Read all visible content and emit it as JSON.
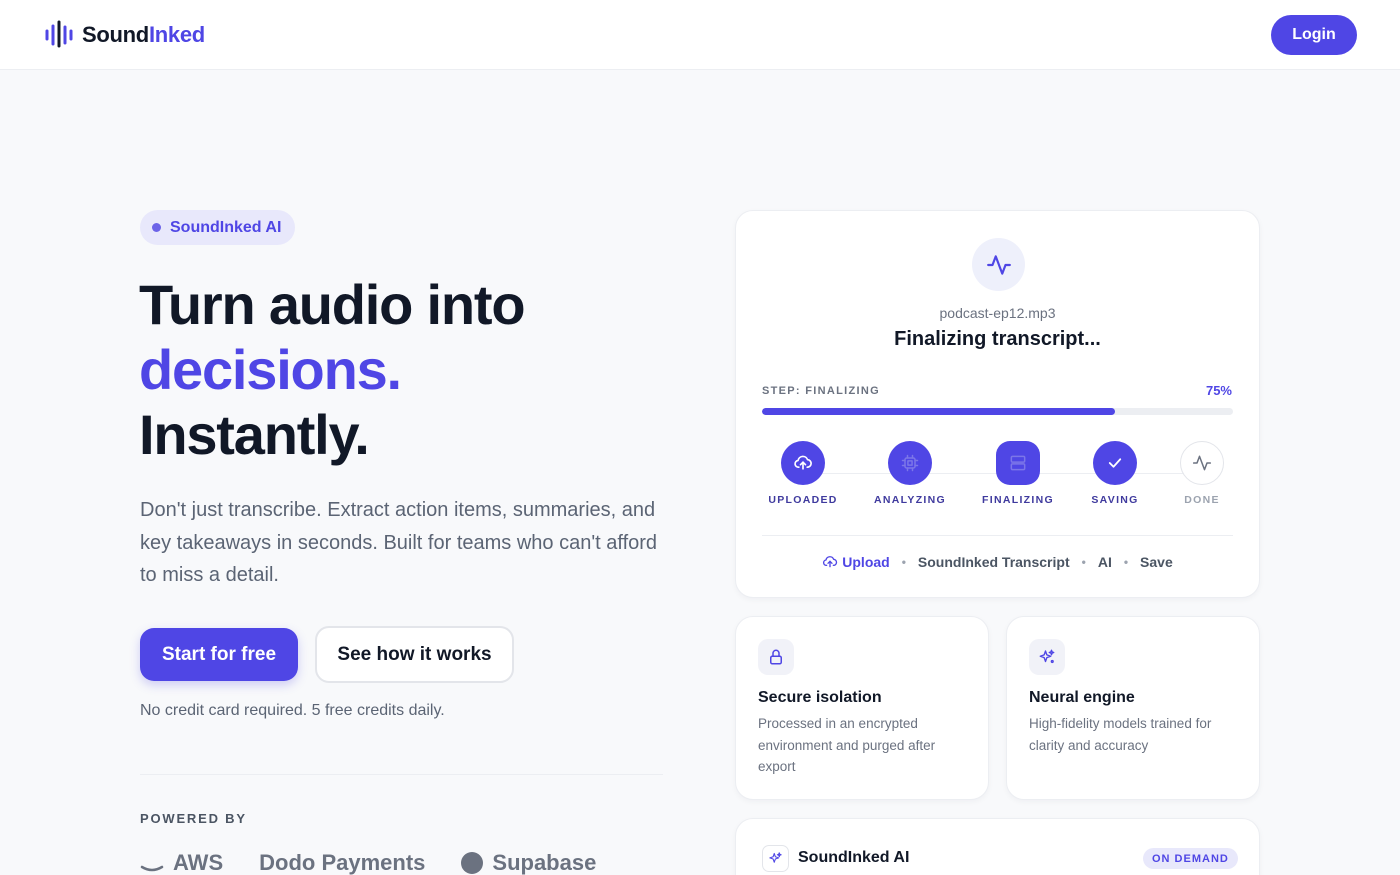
{
  "header": {
    "logo_text_main": "Sound",
    "logo_text_accent": "Inked",
    "logo_icon": "waveform-icon",
    "login_label": "Login"
  },
  "hero": {
    "badge": "SoundInked AI",
    "headline_line1": "Turn audio into",
    "headline_line2": "decisions.",
    "headline_line3": "Instantly.",
    "subtitle": "Don't just transcribe. Extract action items, summaries, and key takeaways in seconds. Built for teams who can't afford to miss a detail.",
    "cta_primary": "Start for free",
    "cta_secondary": "See how it works",
    "fine_print": "No credit card required. 5 free credits daily."
  },
  "powered_by": {
    "label": "POWERED BY",
    "partners": [
      "AWS",
      "Dodo Payments",
      "Supabase"
    ]
  },
  "progress_card": {
    "icon": "activity-icon",
    "filename": "podcast-ep12.mp3",
    "status": "Finalizing transcript...",
    "step_label": "STEP: FINALIZING",
    "percent_label": "75%",
    "progress": 0.75,
    "steps": [
      {
        "label": "UPLOADED",
        "icon": "cloud-upload-icon",
        "state": "complete"
      },
      {
        "label": "ANALYZING",
        "icon": "cpu-icon",
        "state": "complete"
      },
      {
        "label": "FINALIZING",
        "icon": "server-icon",
        "state": "active"
      },
      {
        "label": "SAVING",
        "icon": "check-icon",
        "state": "complete"
      },
      {
        "label": "DONE",
        "icon": "activity-icon",
        "state": "pending"
      }
    ],
    "pipeline": [
      "Upload",
      "SoundInked Transcript",
      "AI",
      "Save"
    ]
  },
  "features": [
    {
      "title": "Secure isolation",
      "description": "Processed in an encrypted environment and purged after export",
      "icon": "lock-icon"
    },
    {
      "title": "Neural engine",
      "description": "High-fidelity models trained for clarity and accuracy",
      "icon": "sparkles-icon"
    }
  ],
  "ai_card": {
    "title": "SoundInked AI",
    "badge": "ON DEMAND",
    "icon": "sparkles-icon"
  },
  "colors": {
    "accent": "#4f46e5",
    "text": "#111827",
    "muted": "#5b6474",
    "background": "#f8f9fb"
  }
}
